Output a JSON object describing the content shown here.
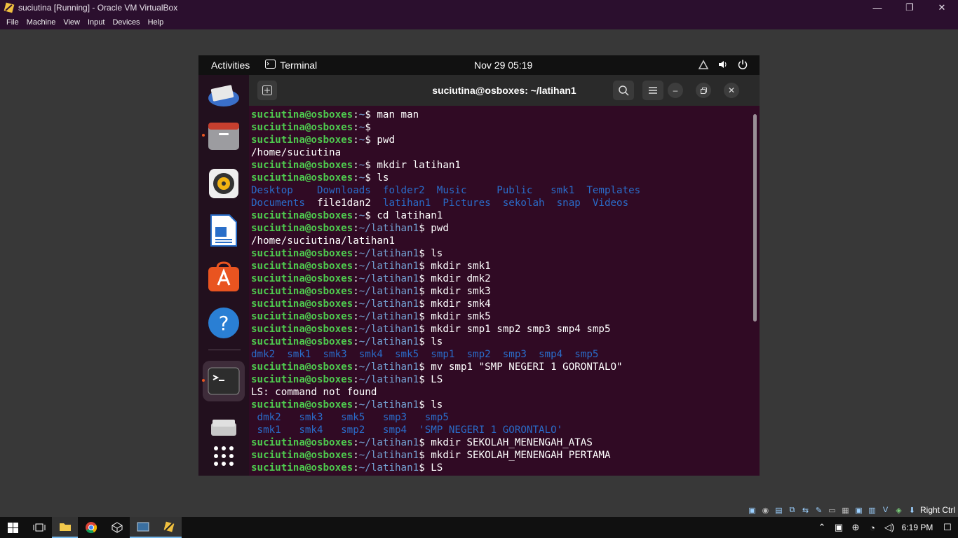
{
  "host": {
    "title": "suciutina [Running] - Oracle VM VirtualBox",
    "menu": [
      "File",
      "Machine",
      "View",
      "Input",
      "Devices",
      "Help"
    ],
    "window_controls": {
      "minimize": "—",
      "restore": "❐",
      "close": "✕"
    },
    "host_key": "Right Ctrl"
  },
  "guest": {
    "topbar": {
      "activities": "Activities",
      "app": "Terminal",
      "clock": "Nov 29  05:19"
    },
    "dock": [
      {
        "name": "thunderbird",
        "icon": "thunderbird-icon"
      },
      {
        "name": "files",
        "icon": "files-icon",
        "running": true
      },
      {
        "name": "rhythmbox",
        "icon": "rhythmbox-icon"
      },
      {
        "name": "writer",
        "icon": "libreoffice-writer-icon"
      },
      {
        "name": "software",
        "icon": "ubuntu-software-icon"
      },
      {
        "name": "help",
        "icon": "help-icon"
      },
      {
        "name": "terminal",
        "icon": "terminal-icon",
        "running": true
      },
      {
        "name": "drive",
        "icon": "drive-icon"
      },
      {
        "name": "apps",
        "icon": "show-apps-icon"
      }
    ],
    "terminal": {
      "title": "suciutina@osboxes: ~/latihan1",
      "lines": [
        [
          {
            "t": "suciutina@osboxes",
            "c": "u"
          },
          {
            "t": ":",
            "c": "pl"
          },
          {
            "t": "~",
            "c": "p"
          },
          {
            "t": "$ man man",
            "c": "pl"
          }
        ],
        [
          {
            "t": "suciutina@osboxes",
            "c": "u"
          },
          {
            "t": ":",
            "c": "pl"
          },
          {
            "t": "~",
            "c": "p"
          },
          {
            "t": "$",
            "c": "pl"
          }
        ],
        [
          {
            "t": "suciutina@osboxes",
            "c": "u"
          },
          {
            "t": ":",
            "c": "pl"
          },
          {
            "t": "~",
            "c": "p"
          },
          {
            "t": "$ pwd",
            "c": "pl"
          }
        ],
        [
          {
            "t": "/home/suciutina",
            "c": "pl"
          }
        ],
        [
          {
            "t": "suciutina@osboxes",
            "c": "u"
          },
          {
            "t": ":",
            "c": "pl"
          },
          {
            "t": "~",
            "c": "p"
          },
          {
            "t": "$ mkdir latihan1",
            "c": "pl"
          }
        ],
        [
          {
            "t": "suciutina@osboxes",
            "c": "u"
          },
          {
            "t": ":",
            "c": "pl"
          },
          {
            "t": "~",
            "c": "p"
          },
          {
            "t": "$ ls",
            "c": "pl"
          }
        ],
        [
          {
            "t": "Desktop    Downloads  folder2  Music     Public   smk1  Templates",
            "c": "d"
          }
        ],
        [
          {
            "t": "Documents  ",
            "c": "d"
          },
          {
            "t": "file1dan2",
            "c": "pl"
          },
          {
            "t": "  latihan1  Pictures  sekolah  snap  Videos",
            "c": "d"
          }
        ],
        [
          {
            "t": "suciutina@osboxes",
            "c": "u"
          },
          {
            "t": ":",
            "c": "pl"
          },
          {
            "t": "~",
            "c": "p"
          },
          {
            "t": "$ cd latihan1",
            "c": "pl"
          }
        ],
        [
          {
            "t": "suciutina@osboxes",
            "c": "u"
          },
          {
            "t": ":",
            "c": "pl"
          },
          {
            "t": "~/latihan1",
            "c": "p"
          },
          {
            "t": "$ pwd",
            "c": "pl"
          }
        ],
        [
          {
            "t": "/home/suciutina/latihan1",
            "c": "pl"
          }
        ],
        [
          {
            "t": "suciutina@osboxes",
            "c": "u"
          },
          {
            "t": ":",
            "c": "pl"
          },
          {
            "t": "~/latihan1",
            "c": "p"
          },
          {
            "t": "$ ls",
            "c": "pl"
          }
        ],
        [
          {
            "t": "suciutina@osboxes",
            "c": "u"
          },
          {
            "t": ":",
            "c": "pl"
          },
          {
            "t": "~/latihan1",
            "c": "p"
          },
          {
            "t": "$ mkdir smk1",
            "c": "pl"
          }
        ],
        [
          {
            "t": "suciutina@osboxes",
            "c": "u"
          },
          {
            "t": ":",
            "c": "pl"
          },
          {
            "t": "~/latihan1",
            "c": "p"
          },
          {
            "t": "$ mkdir dmk2",
            "c": "pl"
          }
        ],
        [
          {
            "t": "suciutina@osboxes",
            "c": "u"
          },
          {
            "t": ":",
            "c": "pl"
          },
          {
            "t": "~/latihan1",
            "c": "p"
          },
          {
            "t": "$ mkdir smk3",
            "c": "pl"
          }
        ],
        [
          {
            "t": "suciutina@osboxes",
            "c": "u"
          },
          {
            "t": ":",
            "c": "pl"
          },
          {
            "t": "~/latihan1",
            "c": "p"
          },
          {
            "t": "$ mkdir smk4",
            "c": "pl"
          }
        ],
        [
          {
            "t": "suciutina@osboxes",
            "c": "u"
          },
          {
            "t": ":",
            "c": "pl"
          },
          {
            "t": "~/latihan1",
            "c": "p"
          },
          {
            "t": "$ mkdir smk5",
            "c": "pl"
          }
        ],
        [
          {
            "t": "suciutina@osboxes",
            "c": "u"
          },
          {
            "t": ":",
            "c": "pl"
          },
          {
            "t": "~/latihan1",
            "c": "p"
          },
          {
            "t": "$ mkdir smp1 smp2 smp3 smp4 smp5",
            "c": "pl"
          }
        ],
        [
          {
            "t": "suciutina@osboxes",
            "c": "u"
          },
          {
            "t": ":",
            "c": "pl"
          },
          {
            "t": "~/latihan1",
            "c": "p"
          },
          {
            "t": "$ ls",
            "c": "pl"
          }
        ],
        [
          {
            "t": "dmk2  smk1  smk3  smk4  smk5  smp1  smp2  smp3  smp4  smp5",
            "c": "d"
          }
        ],
        [
          {
            "t": "suciutina@osboxes",
            "c": "u"
          },
          {
            "t": ":",
            "c": "pl"
          },
          {
            "t": "~/latihan1",
            "c": "p"
          },
          {
            "t": "$ mv smp1 \"SMP NEGERI 1 GORONTALO\"",
            "c": "pl"
          }
        ],
        [
          {
            "t": "suciutina@osboxes",
            "c": "u"
          },
          {
            "t": ":",
            "c": "pl"
          },
          {
            "t": "~/latihan1",
            "c": "p"
          },
          {
            "t": "$ LS",
            "c": "pl"
          }
        ],
        [
          {
            "t": "LS: command not found",
            "c": "pl"
          }
        ],
        [
          {
            "t": "suciutina@osboxes",
            "c": "u"
          },
          {
            "t": ":",
            "c": "pl"
          },
          {
            "t": "~/latihan1",
            "c": "p"
          },
          {
            "t": "$ ls",
            "c": "pl"
          }
        ],
        [
          {
            "t": " dmk2   smk3   smk5   smp3   smp5",
            "c": "d"
          }
        ],
        [
          {
            "t": " smk1   smk4   smp2   smp4  'SMP NEGERI 1 GORONTALO'",
            "c": "d"
          }
        ],
        [
          {
            "t": "suciutina@osboxes",
            "c": "u"
          },
          {
            "t": ":",
            "c": "pl"
          },
          {
            "t": "~/latihan1",
            "c": "p"
          },
          {
            "t": "$ mkdir SEKOLAH_MENENGAH_ATAS",
            "c": "pl"
          }
        ],
        [
          {
            "t": "suciutina@osboxes",
            "c": "u"
          },
          {
            "t": ":",
            "c": "pl"
          },
          {
            "t": "~/latihan1",
            "c": "p"
          },
          {
            "t": "$ mkdir SEKOLAH_MENENGAH PERTAMA",
            "c": "pl"
          }
        ],
        [
          {
            "t": "suciutina@osboxes",
            "c": "u"
          },
          {
            "t": ":",
            "c": "pl"
          },
          {
            "t": "~/latihan1",
            "c": "p"
          },
          {
            "t": "$ LS",
            "c": "pl"
          }
        ]
      ]
    }
  },
  "taskbar": {
    "time": "6:19 PM"
  },
  "colors": {
    "terminal_bg": "#300a24",
    "user_green": "#4ec94e",
    "path_blue": "#729fcf",
    "dir_blue": "#2a6cc9",
    "ubuntu_orange": "#e95420"
  }
}
